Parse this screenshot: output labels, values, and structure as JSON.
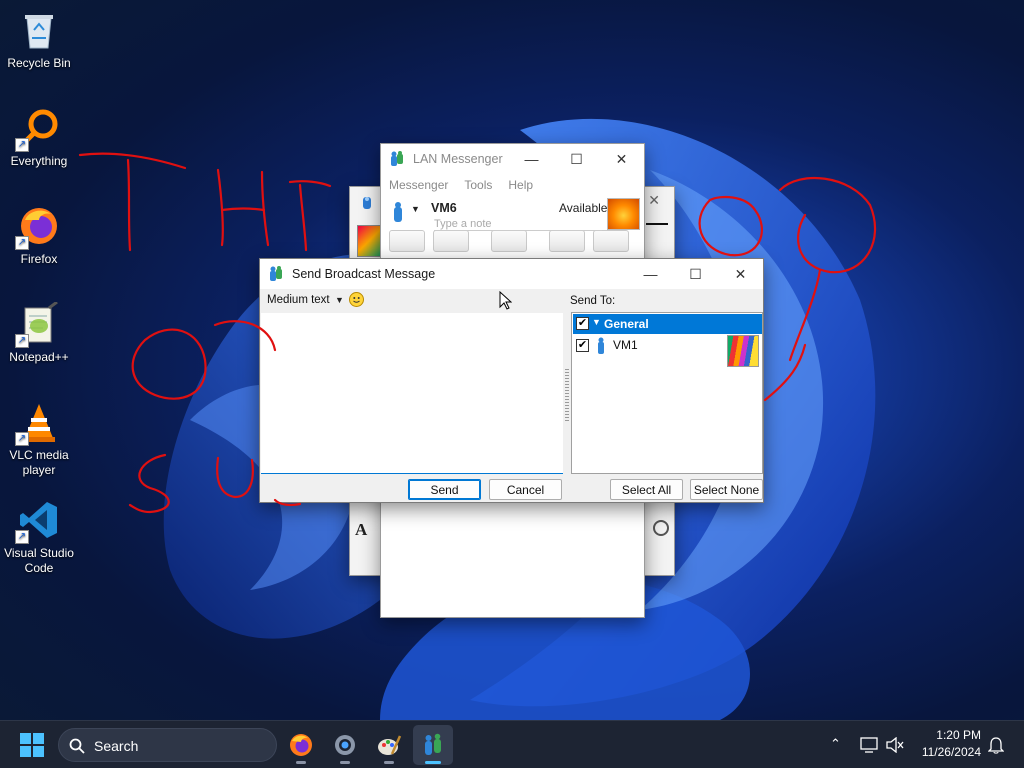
{
  "desktop": {
    "icons": [
      {
        "label": "Recycle Bin",
        "icon": "recycle-bin-icon"
      },
      {
        "label": "Everything",
        "icon": "everything-search-icon"
      },
      {
        "label": "Firefox",
        "icon": "firefox-icon"
      },
      {
        "label": "Notepad++",
        "icon": "notepad-plus-plus-icon"
      },
      {
        "label": "VLC media player",
        "icon": "vlc-icon"
      },
      {
        "label": "Visual Studio Code",
        "icon": "vscode-icon"
      }
    ]
  },
  "lan_messenger": {
    "title": "LAN Messenger",
    "menu": [
      "Messenger",
      "Tools",
      "Help"
    ],
    "user_name": "VM6",
    "status": "Available",
    "note_placeholder": "Type a note"
  },
  "broadcast": {
    "title": "Send Broadcast Message",
    "font_size_label": "Medium text",
    "send_to_label": "Send To:",
    "group_name": "General",
    "group_checked": true,
    "contacts": [
      {
        "name": "VM1",
        "checked": true
      }
    ],
    "send_label": "Send",
    "cancel_label": "Cancel",
    "select_all_label": "Select All",
    "select_none_label": "Select None"
  },
  "taskbar": {
    "search_label": "Search",
    "time": "1:20 PM",
    "date": "11/26/2024"
  },
  "colors": {
    "accent": "#0078d4",
    "selection": "#0078d7",
    "scribble": "#e01010"
  }
}
